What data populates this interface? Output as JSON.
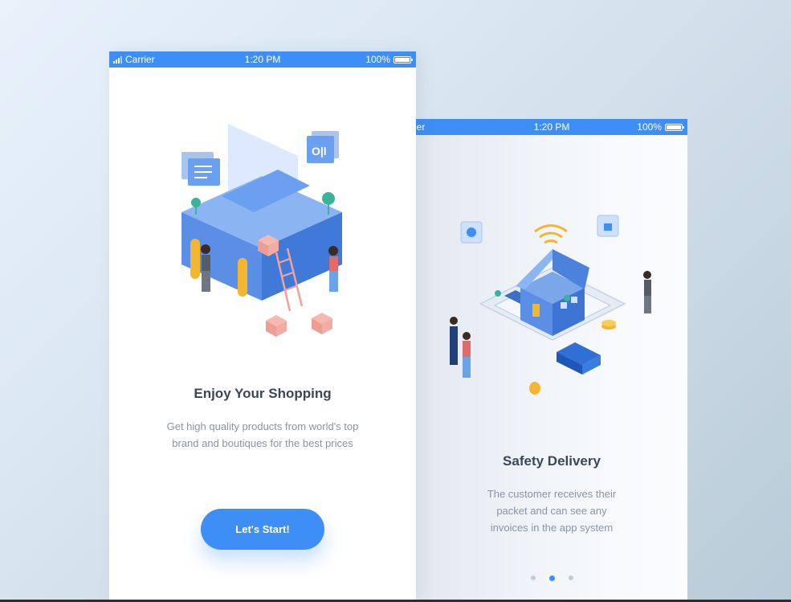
{
  "front_screen": {
    "status": {
      "carrier": "Carrier",
      "time": "1:20 PM",
      "battery": "100%"
    },
    "title": "Enjoy Your Shopping",
    "description": "Get high quality products from world's top brand and boutiques for the best prices",
    "cta_label": "Let's Start!",
    "illustration": "isometric-shopping-store-illustration"
  },
  "back_screen": {
    "status": {
      "carrier": "rier",
      "time": "1:20 PM",
      "battery": "100%"
    },
    "title": "Safety Delivery",
    "description": "The customer receives their packet and can see any invoices in the app system",
    "illustration": "isometric-delivery-house-illustration",
    "pagination": {
      "count": 3,
      "active": 2
    }
  },
  "colors": {
    "accent": "#3d8ef6",
    "title": "#3b4658",
    "body": "#8a94a4"
  }
}
